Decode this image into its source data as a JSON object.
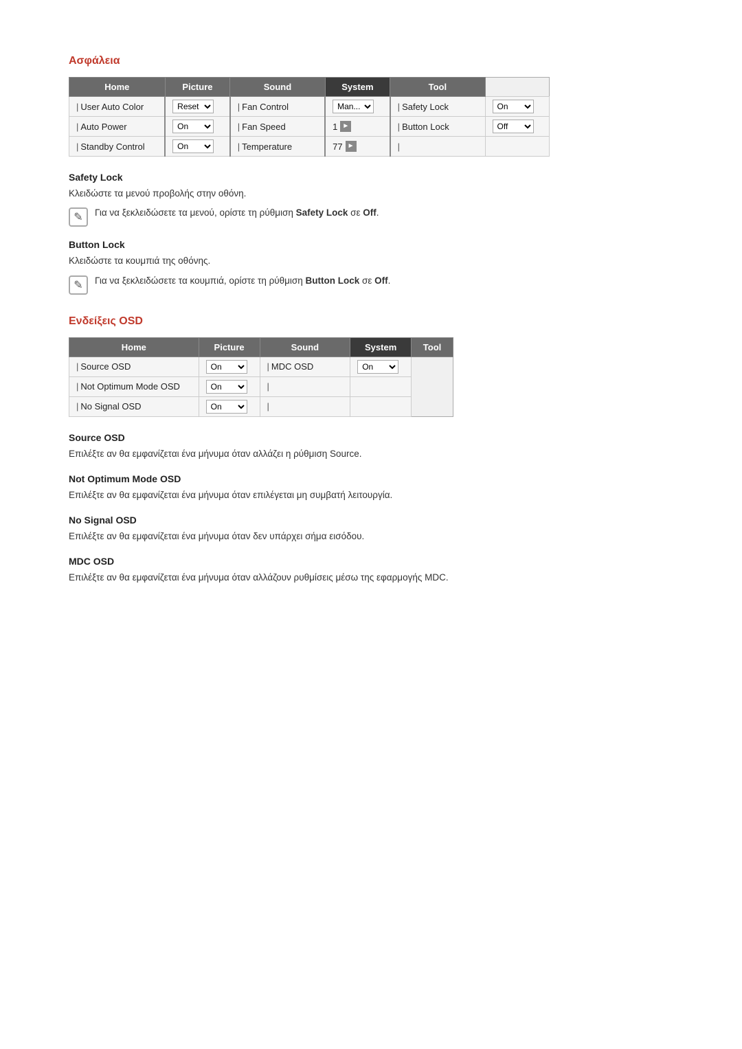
{
  "asfaleia": {
    "title": "Ασφάλεια",
    "table": {
      "tabs": [
        {
          "label": "Home",
          "active": false
        },
        {
          "label": "Picture",
          "active": false
        },
        {
          "label": "Sound",
          "active": false
        },
        {
          "label": "System",
          "active": true
        },
        {
          "label": "Tool",
          "active": false
        }
      ],
      "rows": [
        {
          "col1_label": "User Auto Color",
          "col1_value": "Reset",
          "col1_type": "select",
          "col2_label": "Fan Control",
          "col2_value": "Man...",
          "col2_type": "select",
          "col3_label": "Safety Lock",
          "col3_value": "On",
          "col3_type": "select"
        },
        {
          "col1_label": "Auto Power",
          "col1_value": "On",
          "col1_type": "select",
          "col2_label": "Fan Speed",
          "col2_value": "1",
          "col2_type": "arrow",
          "col3_label": "Button Lock",
          "col3_value": "Off",
          "col3_type": "select"
        },
        {
          "col1_label": "Standby Control",
          "col1_value": "On",
          "col1_type": "select",
          "col2_label": "Temperature",
          "col2_value": "77",
          "col2_type": "arrow",
          "col3_label": "",
          "col3_value": "",
          "col3_type": "none"
        }
      ]
    },
    "safety_lock": {
      "heading": "Safety Lock",
      "desc": "Κλειδώστε τα μενού προβολής στην οθόνη.",
      "note": "Για να ξεκλειδώσετε τα μενού, ορίστε τη ρύθμιση Safety Lock σε Off.",
      "note_bold": "Safety Lock",
      "note_suffix": "σε Off."
    },
    "button_lock": {
      "heading": "Button Lock",
      "desc": "Κλειδώστε τα κουμπιά της οθόνης.",
      "note": "Για να ξεκλειδώσετε τα κουμπιά, ορίστε τη ρύθμιση Button Lock σε Off.",
      "note_bold": "Button Lock",
      "note_suffix": "σε Off."
    }
  },
  "endikseis_osd": {
    "title": "Ενδείξεις OSD",
    "table": {
      "tabs": [
        {
          "label": "Home",
          "active": false
        },
        {
          "label": "Picture",
          "active": false
        },
        {
          "label": "Sound",
          "active": false
        },
        {
          "label": "System",
          "active": true
        },
        {
          "label": "Tool",
          "active": false
        }
      ],
      "rows": [
        {
          "col1_label": "Source OSD",
          "col1_value": "On",
          "col1_type": "select",
          "col2_label": "MDC OSD",
          "col2_value": "On",
          "col2_type": "select"
        },
        {
          "col1_label": "Not Optimum Mode OSD",
          "col1_value": "On",
          "col1_type": "select",
          "col2_label": "",
          "col2_value": "",
          "col2_type": "none"
        },
        {
          "col1_label": "No Signal OSD",
          "col1_value": "On",
          "col1_type": "select",
          "col2_label": "",
          "col2_value": "",
          "col2_type": "none"
        }
      ]
    },
    "source_osd": {
      "heading": "Source OSD",
      "desc": "Επιλέξτε αν θα εμφανίζεται ένα μήνυμα όταν αλλάζει η ρύθμιση Source."
    },
    "not_optimum_osd": {
      "heading": "Not Optimum Mode OSD",
      "desc": "Επιλέξτε αν θα εμφανίζεται ένα μήνυμα όταν επιλέγεται μη συμβατή λειτουργία."
    },
    "no_signal_osd": {
      "heading": "No Signal OSD",
      "desc": "Επιλέξτε αν θα εμφανίζεται ένα μήνυμα όταν δεν υπάρχει σήμα εισόδου."
    },
    "mdc_osd": {
      "heading": "MDC OSD",
      "desc": "Επιλέξτε αν θα εμφανίζεται ένα μήνυμα όταν αλλάζουν ρυθμίσεις μέσω της εφαρμογής MDC."
    }
  }
}
